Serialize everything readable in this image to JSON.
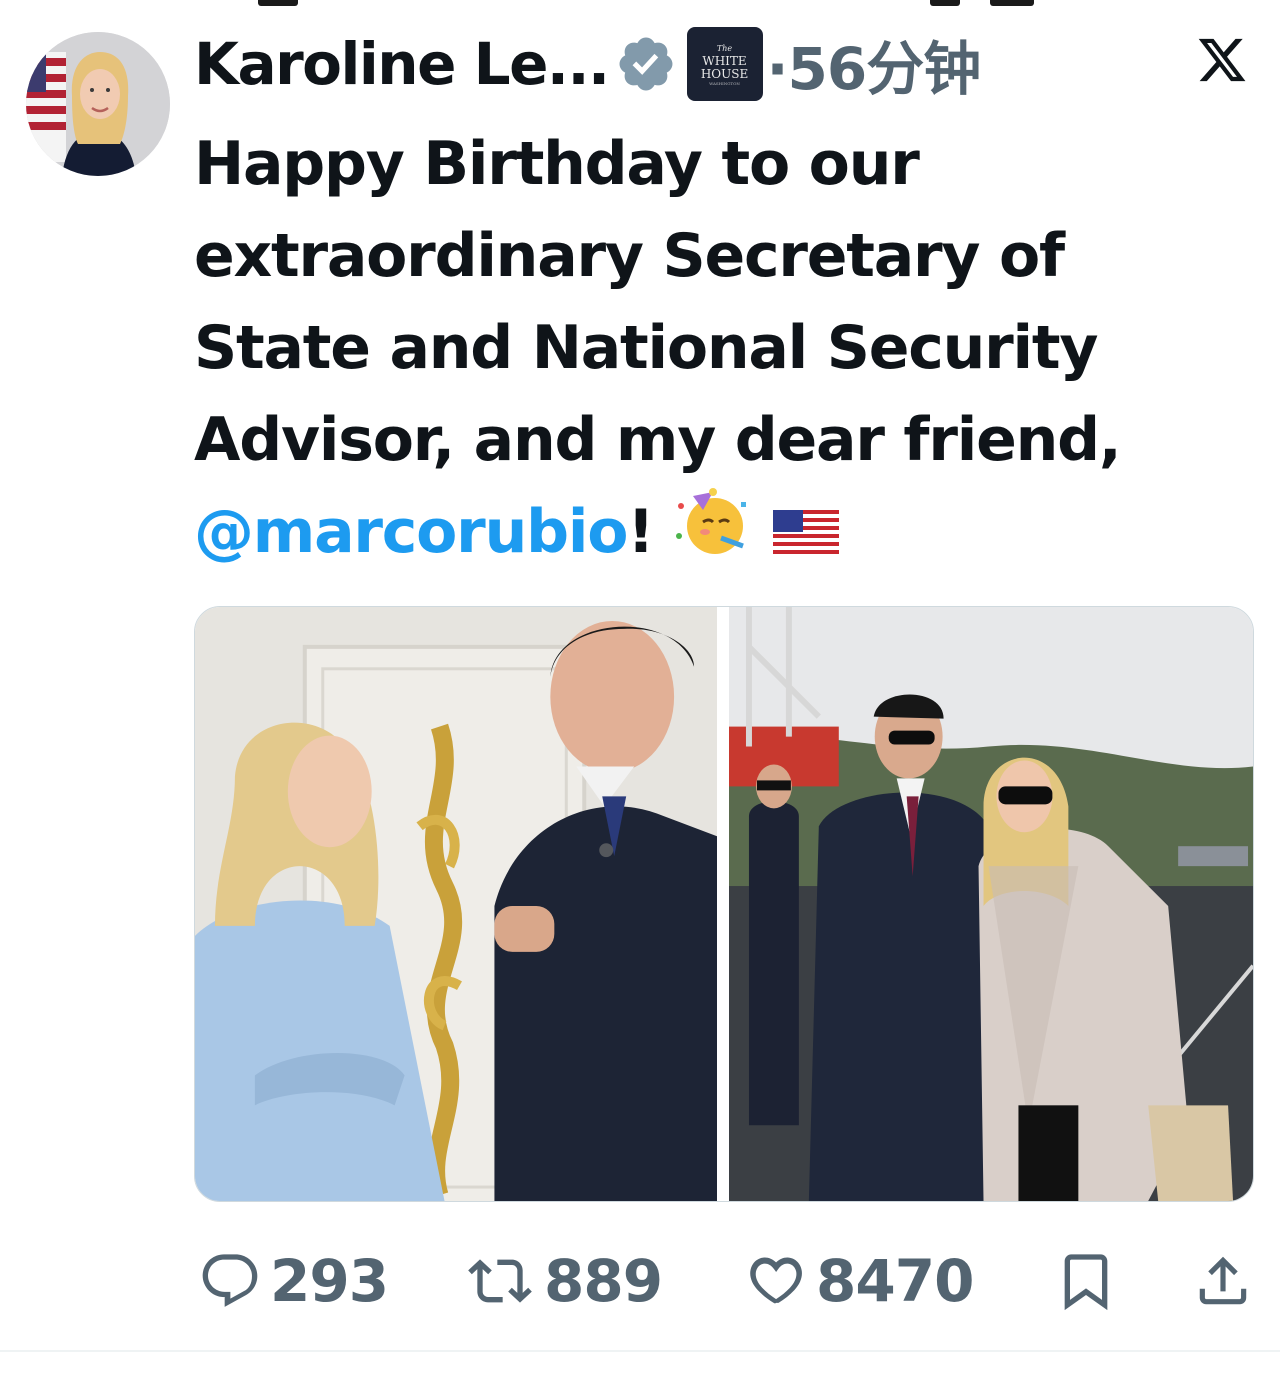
{
  "tweet": {
    "author_name": "Karoline Le...",
    "time": "·56分钟",
    "affiliation_badge": {
      "line1": "The",
      "line2": "WHITE",
      "line3": "HOUSE",
      "line4": "WASHINGTON"
    },
    "text_lines": [
      "Happy Birthday to our",
      "extraordinary Secretary of",
      "State and National Security",
      "Advisor, and my dear friend,"
    ],
    "mention": "@marcorubio",
    "after_mention": "!",
    "emojis": [
      "partying-face-emoji",
      "us-flag-emoji"
    ],
    "images": [
      {
        "name": "photo-indoor-ornate-door"
      },
      {
        "name": "photo-aircraft-carrier-deck"
      }
    ]
  },
  "actions": {
    "replies": "293",
    "reposts": "889",
    "likes": "8470"
  },
  "icons": {
    "verified": "verified-badge-icon",
    "platform": "x-logo-icon",
    "reply": "reply-icon",
    "repost": "repost-icon",
    "like": "heart-icon",
    "bookmark": "bookmark-icon",
    "share": "share-icon"
  },
  "colors": {
    "text": "#0f1419",
    "muted": "#536471",
    "link": "#1d9bf0",
    "verified_badge": "#829aab"
  }
}
